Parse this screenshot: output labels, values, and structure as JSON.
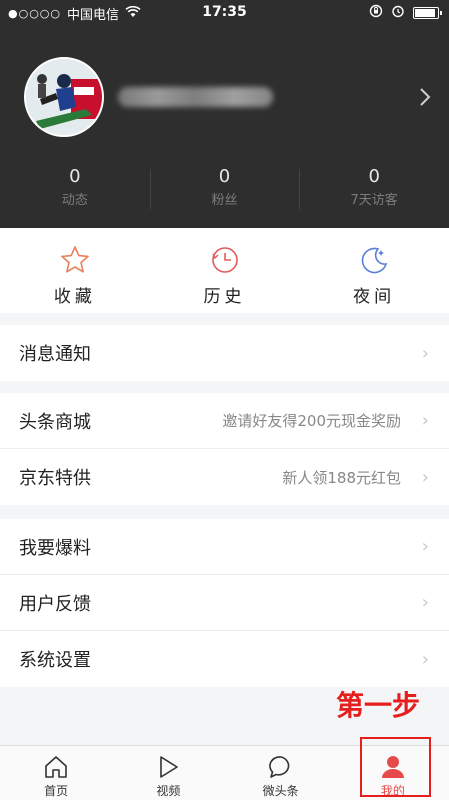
{
  "status_bar": {
    "signal": "●○○○○",
    "carrier": "中国电信",
    "time": "17:35"
  },
  "profile": {
    "username": ""
  },
  "stats": [
    {
      "value": "0",
      "label": "动态"
    },
    {
      "value": "0",
      "label": "粉丝"
    },
    {
      "value": "0",
      "label": "7天访客"
    }
  ],
  "quick_actions": [
    {
      "label": "收藏",
      "icon": "star-icon"
    },
    {
      "label": "历史",
      "icon": "clock-icon"
    },
    {
      "label": "夜间",
      "icon": "moon-icon"
    }
  ],
  "group1": [
    {
      "label": "消息通知",
      "sub": ""
    }
  ],
  "group2": [
    {
      "label": "头条商城",
      "sub": "邀请好友得200元现金奖励"
    },
    {
      "label": "京东特供",
      "sub": "新人领188元红包"
    }
  ],
  "group3": [
    {
      "label": "我要爆料",
      "sub": ""
    },
    {
      "label": "用户反馈",
      "sub": ""
    },
    {
      "label": "系统设置",
      "sub": ""
    }
  ],
  "annotation": "第一步",
  "tabs": [
    {
      "label": "首页",
      "icon": "home-icon"
    },
    {
      "label": "视频",
      "icon": "play-icon"
    },
    {
      "label": "微头条",
      "icon": "chat-bubble-icon"
    },
    {
      "label": "我的",
      "icon": "person-icon"
    }
  ],
  "colors": {
    "accent": "#e74a4a",
    "header_bg": "#2e2e2e",
    "annotation": "#e61e1e"
  }
}
